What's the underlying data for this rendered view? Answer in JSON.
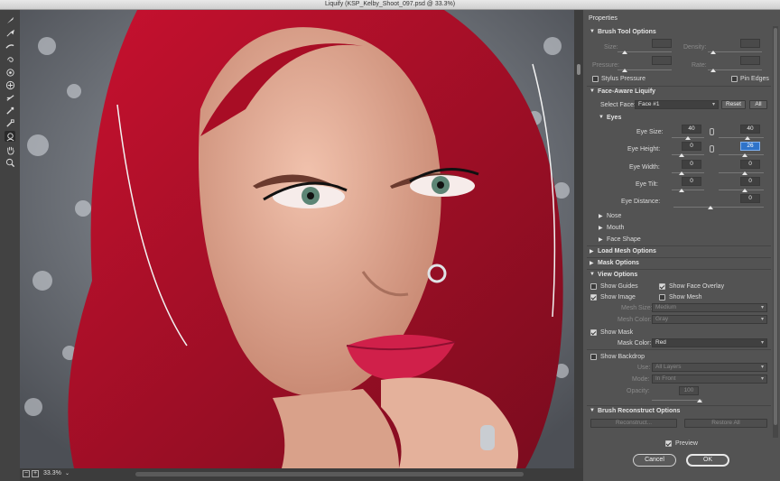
{
  "window": {
    "title": "Liquify (KSP_Kelby_Shoot_097.psd @ 33.3%)"
  },
  "tools": [
    "forward-warp-icon",
    "reconstruct-icon",
    "smooth-icon",
    "twirl-icon",
    "pucker-icon",
    "bloat-icon",
    "push-left-icon",
    "freeze-mask-icon",
    "thaw-mask-icon",
    "face-tool-icon",
    "hand-icon",
    "zoom-icon"
  ],
  "status": {
    "zoom": "33.3%",
    "minus": "−",
    "plus": "+",
    "zoom_arrow": "⌄"
  },
  "panel": {
    "title": "Properties",
    "brush": {
      "header": "Brush Tool Options",
      "size": "Size:",
      "density": "Density:",
      "pressure": "Pressure:",
      "rate": "Rate:",
      "stylus": "Stylus Pressure",
      "pin_edges": "Pin Edges"
    },
    "face": {
      "header": "Face-Aware Liquify",
      "select_face": "Select Face:",
      "face_value": "Face #1",
      "reset": "Reset",
      "all": "All",
      "eyes": "Eyes",
      "eye_size": "Eye Size:",
      "eye_size_l": "40",
      "eye_size_r": "40",
      "eye_height": "Eye Height:",
      "eye_height_l": "0",
      "eye_height_r": "26",
      "eye_width": "Eye Width:",
      "eye_width_l": "0",
      "eye_width_r": "0",
      "eye_tilt": "Eye Tilt:",
      "eye_tilt_l": "0",
      "eye_tilt_r": "0",
      "eye_distance": "Eye Distance:",
      "eye_distance_v": "0",
      "nose": "Nose",
      "mouth": "Mouth",
      "face_shape": "Face Shape"
    },
    "load_mesh": "Load Mesh Options",
    "mask_options": "Mask Options",
    "view": {
      "header": "View Options",
      "show_guides": "Show Guides",
      "show_face_overlay": "Show Face Overlay",
      "show_image": "Show Image",
      "show_mesh": "Show Mesh",
      "mesh_size": "Mesh Size:",
      "mesh_size_v": "Medium",
      "mesh_color": "Mesh Color:",
      "mesh_color_v": "Gray",
      "show_mask": "Show Mask",
      "mask_color": "Mask Color:",
      "mask_color_v": "Red",
      "show_backdrop": "Show Backdrop",
      "use": "Use:",
      "use_v": "All Layers",
      "mode": "Mode:",
      "mode_v": "In Front",
      "opacity": "Opacity:",
      "opacity_v": "100"
    },
    "reconstruct": {
      "header": "Brush Reconstruct Options",
      "reconstruct_btn": "Reconstruct...",
      "restore_all": "Restore All"
    },
    "preview": "Preview",
    "cancel": "Cancel",
    "ok": "OK"
  },
  "colors": {
    "hair": "#b0102a",
    "lips": "#d0204a",
    "highlight": "#2f73c9"
  }
}
